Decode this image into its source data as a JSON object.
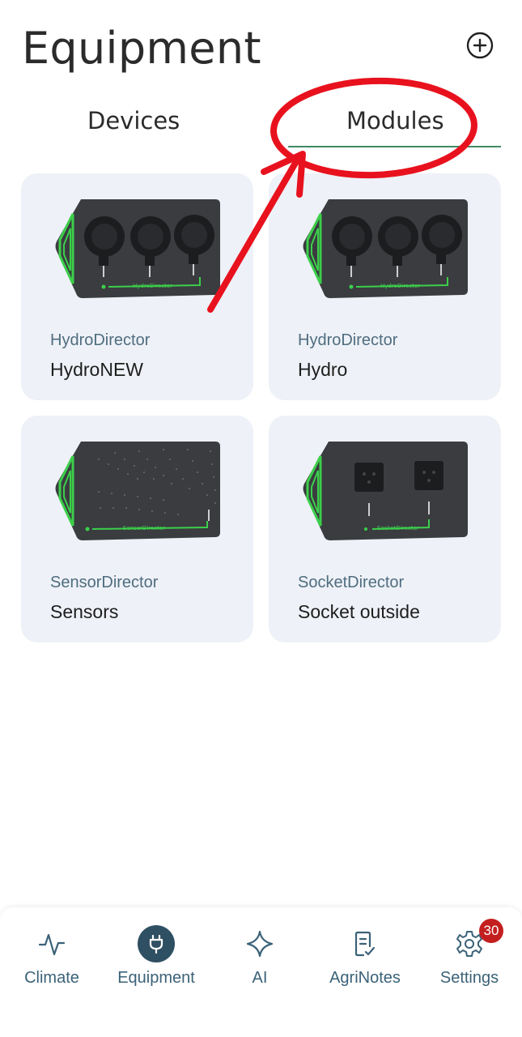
{
  "header": {
    "title": "Equipment"
  },
  "tabs": [
    {
      "label": "Devices",
      "active": false
    },
    {
      "label": "Modules",
      "active": true
    }
  ],
  "cards": [
    {
      "type": "HydroDirector",
      "name": "HydroNEW",
      "image": "hydro-director-device"
    },
    {
      "type": "HydroDirector",
      "name": "Hydro",
      "image": "hydro-director-device"
    },
    {
      "type": "SensorDirector",
      "name": "Sensors",
      "image": "sensor-director-device"
    },
    {
      "type": "SocketDirector",
      "name": "Socket outside",
      "image": "socket-director-device"
    }
  ],
  "bottom_nav": [
    {
      "label": "Climate",
      "icon": "activity-icon"
    },
    {
      "label": "Equipment",
      "icon": "plug-icon",
      "active": true
    },
    {
      "label": "AI",
      "icon": "sparkle-icon"
    },
    {
      "label": "AgriNotes",
      "icon": "note-check-icon"
    },
    {
      "label": "Settings",
      "icon": "gear-icon",
      "badge": "30"
    }
  ],
  "colors": {
    "accent": "#3f8a63",
    "card_bg": "#eef1f7",
    "nav_label": "#3b6278",
    "active_nav": "#2f4f63",
    "badge": "#c41f1f",
    "annotation": "#e8121e"
  }
}
